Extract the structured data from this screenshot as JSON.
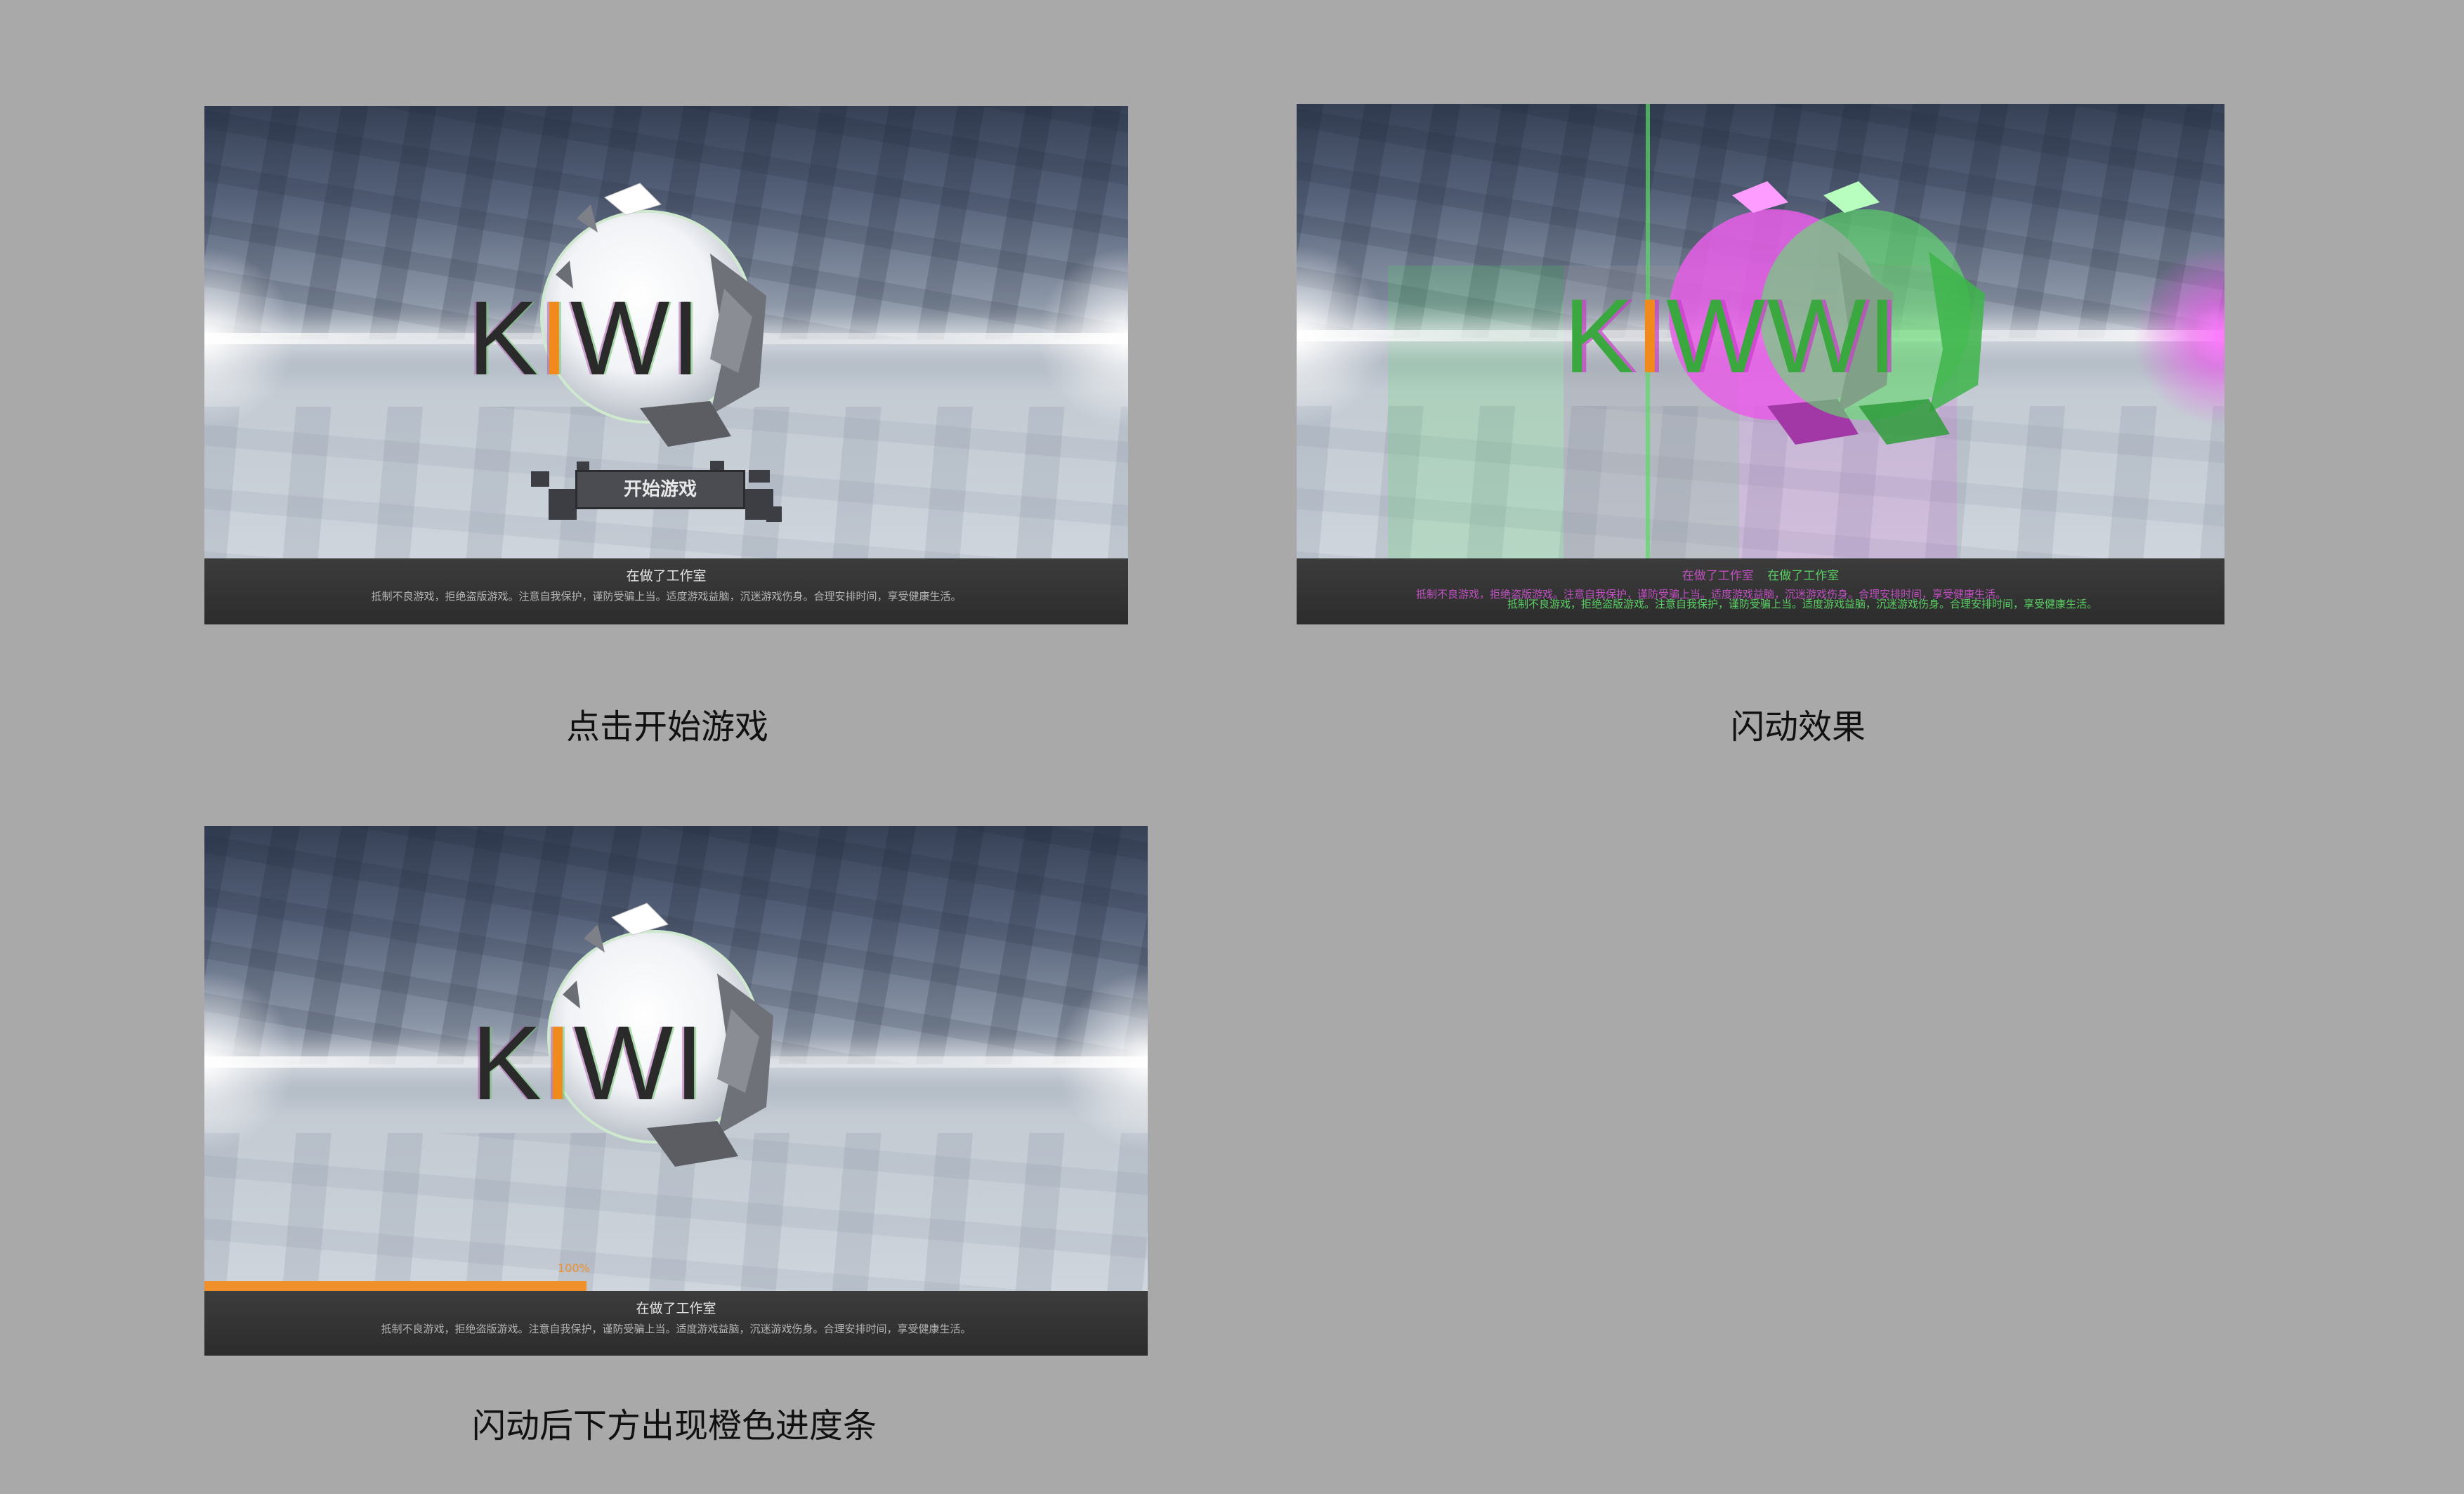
{
  "panels": {
    "p1": {
      "logo": {
        "k": "K",
        "i": "I",
        "wi": "WI"
      },
      "start_button": "开始游戏",
      "footer": {
        "studio": "在做了工作室",
        "notice": "抵制不良游戏，拒绝盗版游戏。注意自我保护，谨防受骗上当。适度游戏益脑，沉迷游戏伤身。合理安排时间，享受健康生活。"
      },
      "caption": "点击开始游戏"
    },
    "p2": {
      "logo_green": {
        "k": "K",
        "i": "I",
        "rest": "WWI"
      },
      "footer": {
        "studio_magenta": "在做了工作室",
        "studio_green": "在做了工作室",
        "notice_magenta": "抵制不良游戏，拒绝盗版游戏。注意自我保护，谨防受骗上当。适度游戏益脑，沉迷游戏伤身。合理安排时间，享受健康生活。",
        "notice_green": "抵制不良游戏，拒绝盗版游戏。注意自我保护，谨防受骗上当。适度游戏益脑，沉迷游戏伤身。合理安排时间，享受健康生活。"
      },
      "caption": "闪动效果"
    },
    "p3": {
      "logo": {
        "k": "K",
        "i": "I",
        "wi": "WI"
      },
      "progress": {
        "percent_label": "100%",
        "fill_fraction": 0.405
      },
      "footer": {
        "studio": "在做了工作室",
        "notice": "抵制不良游戏，拒绝盗版游戏。注意自我保护，谨防受骗上当。适度游戏益脑，沉迷游戏伤身。合理安排时间，享受健康生活。"
      },
      "caption": "闪动后下方出现橙色进度条"
    }
  },
  "colors": {
    "accent_orange": "#f0902a",
    "glitch_magenta": "#e040e0",
    "glitch_green": "#3ee05a",
    "page_bg": "#a9a9a9"
  }
}
